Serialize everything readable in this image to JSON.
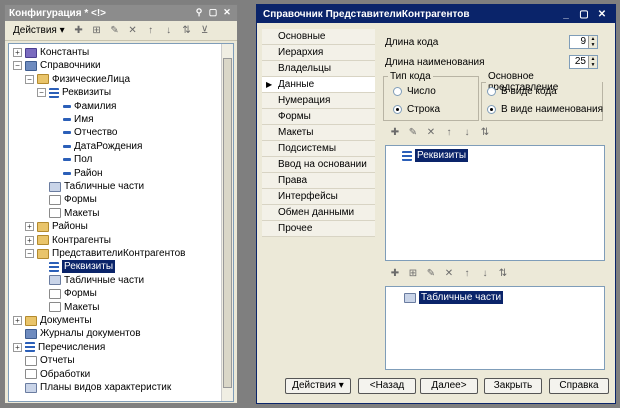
{
  "config": {
    "title": "Конфигурация * <!>",
    "title_buttons": [
      "⚲",
      "▢",
      "✕"
    ],
    "actions_label": "Действия ▾",
    "toolbar_icons": [
      "add-icon",
      "add-child-icon",
      "edit-icon",
      "delete-icon",
      "move-up-icon",
      "move-down-icon",
      "sort-icon",
      "filter-icon"
    ],
    "tree": [
      {
        "label": "Константы",
        "level": 0,
        "pm": "+",
        "icon": "star"
      },
      {
        "label": "Справочники",
        "level": 0,
        "pm": "−",
        "icon": "book"
      },
      {
        "label": "ФизическиеЛица",
        "level": 1,
        "pm": "−",
        "icon": "folder"
      },
      {
        "label": "Реквизиты",
        "level": 2,
        "pm": "−",
        "icon": "list"
      },
      {
        "label": "Фамилия",
        "level": 3,
        "pm": "",
        "icon": "dash"
      },
      {
        "label": "Имя",
        "level": 3,
        "pm": "",
        "icon": "dash"
      },
      {
        "label": "Отчество",
        "level": 3,
        "pm": "",
        "icon": "dash"
      },
      {
        "label": "ДатаРождения",
        "level": 3,
        "pm": "",
        "icon": "dash"
      },
      {
        "label": "Пол",
        "level": 3,
        "pm": "",
        "icon": "dash"
      },
      {
        "label": "Район",
        "level": 3,
        "pm": "",
        "icon": "dash"
      },
      {
        "label": "Табличные части",
        "level": 2,
        "pm": "",
        "icon": "grid"
      },
      {
        "label": "Формы",
        "level": 2,
        "pm": "",
        "icon": "page"
      },
      {
        "label": "Макеты",
        "level": 2,
        "pm": "",
        "icon": "page"
      },
      {
        "label": "Районы",
        "level": 1,
        "pm": "+",
        "icon": "folder"
      },
      {
        "label": "Контрагенты",
        "level": 1,
        "pm": "+",
        "icon": "folder"
      },
      {
        "label": "ПредставителиКонтрагентов",
        "level": 1,
        "pm": "−",
        "icon": "folder"
      },
      {
        "label": "Реквизиты",
        "level": 2,
        "pm": "",
        "icon": "list",
        "selected": true
      },
      {
        "label": "Табличные части",
        "level": 2,
        "pm": "",
        "icon": "grid"
      },
      {
        "label": "Формы",
        "level": 2,
        "pm": "",
        "icon": "page"
      },
      {
        "label": "Макеты",
        "level": 2,
        "pm": "",
        "icon": "page"
      },
      {
        "label": "Документы",
        "level": 0,
        "pm": "+",
        "icon": "folder"
      },
      {
        "label": "Журналы документов",
        "level": 0,
        "pm": "",
        "icon": "book"
      },
      {
        "label": "Перечисления",
        "level": 0,
        "pm": "+",
        "icon": "list"
      },
      {
        "label": "Отчеты",
        "level": 0,
        "pm": "",
        "icon": "page"
      },
      {
        "label": "Обработки",
        "level": 0,
        "pm": "",
        "icon": "page"
      },
      {
        "label": "Планы видов характеристик",
        "level": 0,
        "pm": "",
        "icon": "grid"
      }
    ]
  },
  "dialog": {
    "title": "Справочник ПредставителиКонтрагентов",
    "title_buttons": [
      "_",
      "▢",
      "✕"
    ],
    "nav": [
      "Основные",
      "Иерархия",
      "Владельцы",
      "Данные",
      "Нумерация",
      "Формы",
      "Макеты",
      "Подсистемы",
      "Ввод на основании",
      "Права",
      "Интерфейсы",
      "Обмен данными",
      "Прочее"
    ],
    "nav_current": 3,
    "code_length_label": "Длина кода",
    "code_length": "9",
    "name_length_label": "Длина наименования",
    "name_length": "25",
    "code_type": {
      "title": "Тип кода",
      "options": [
        "Число",
        "Строка"
      ],
      "selected": 1
    },
    "main_repr": {
      "title": "Основное представление",
      "options": [
        "В виде кода",
        "В виде наименования"
      ],
      "selected": 1
    },
    "attrs_item": "Реквизиты",
    "tabparts_item": "Табличные части",
    "buttons": {
      "actions": "Действия",
      "back": "<Назад",
      "next": "Далее>",
      "close": "Закрыть",
      "help": "Справка"
    }
  }
}
